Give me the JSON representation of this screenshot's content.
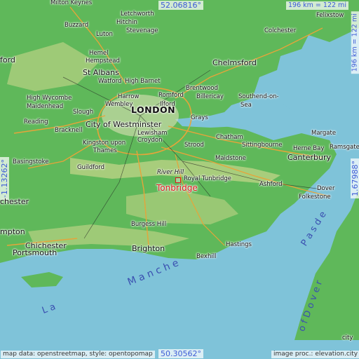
{
  "coordinates": {
    "top": "52.06816°",
    "bottom": "50.30562°",
    "left": "-1.13262°",
    "right": "1.67988°"
  },
  "scale": {
    "horizontal": "196 km = 122 mi",
    "vertical": "196 km = 122 mi"
  },
  "attribution": {
    "left": "map data: openstreetmap, style: opentopomap",
    "right": "image proc.: elevation.city"
  },
  "highlight": {
    "name": "Tonbridge",
    "color": "#e0181c"
  },
  "colors": {
    "sea": "#7fc3d9",
    "land": "#5fb85a",
    "highland": "#c8d68a",
    "motorway": "#e6a43a",
    "label_blue": "#3d5bd6"
  },
  "places": {
    "milton_keynes": "Milton Keynes",
    "letchworth": "Letchworth",
    "buzzard": "Buzzard",
    "hitchin": "Hitchin",
    "stevenage": "Stevenage",
    "luton": "Luton",
    "hemel": "Hemel",
    "hempstead": "Hempstead",
    "st_albans": "St Albans",
    "watford": "Watford",
    "high_barnet": "High Barnet",
    "ford": "ford",
    "harrow": "Harrow",
    "romford": "Romford",
    "billericay": "Billericay",
    "high_wycombe": "High Wycombe",
    "maidenhead": "Maidenhead",
    "slough": "Slough",
    "wembley": "Wembley",
    "ilford": "Ilford",
    "london": "LONDON",
    "city_of_westminster": "City of Westminster",
    "lewisham": "Lewisham",
    "reading": "Reading",
    "bracknell": "Bracknell",
    "croydon": "Croydon",
    "kingston_upon_thames_1": "Kingston upon",
    "kingston_upon_thames_2": "Thames",
    "basingstoke": "Basingstoke",
    "guildford": "Guildford",
    "chelmsford": "Chelmsford",
    "brentwood": "Brentwood",
    "southend_1": "Southend-on-",
    "southend_2": "Sea",
    "grays": "Grays",
    "colchester": "Colchester",
    "felixstowe": "Felixstow",
    "chatham": "Chatham",
    "strood": "Strood",
    "sittingbourne": "Sittingbourne",
    "maidstone": "Maidstone",
    "margate": "Margate",
    "herne_bay": "Herne Bay",
    "ramsgate": "Ramsgate",
    "canterbury": "Canterbury",
    "river_hill": "River Hill",
    "royal_tunbridge": "Royal Tunbridge",
    "ashford": "Ashford",
    "dover": "Dover",
    "folkestone": "Folkestone",
    "chester": "chester",
    "burgess_hill": "Burgess Hill",
    "mpton": "mpton",
    "chichester": "Chichester",
    "portsmouth": "Portsmouth",
    "brighton": "Brighton",
    "hastings": "Hastings",
    "bexhill": "Bexhill"
  },
  "water_labels": {
    "la": "L a",
    "manche": "M a n c h e",
    "pas_de": "P a s  d e",
    "of_dover": "o f  D o v e r",
    "city": "city"
  }
}
